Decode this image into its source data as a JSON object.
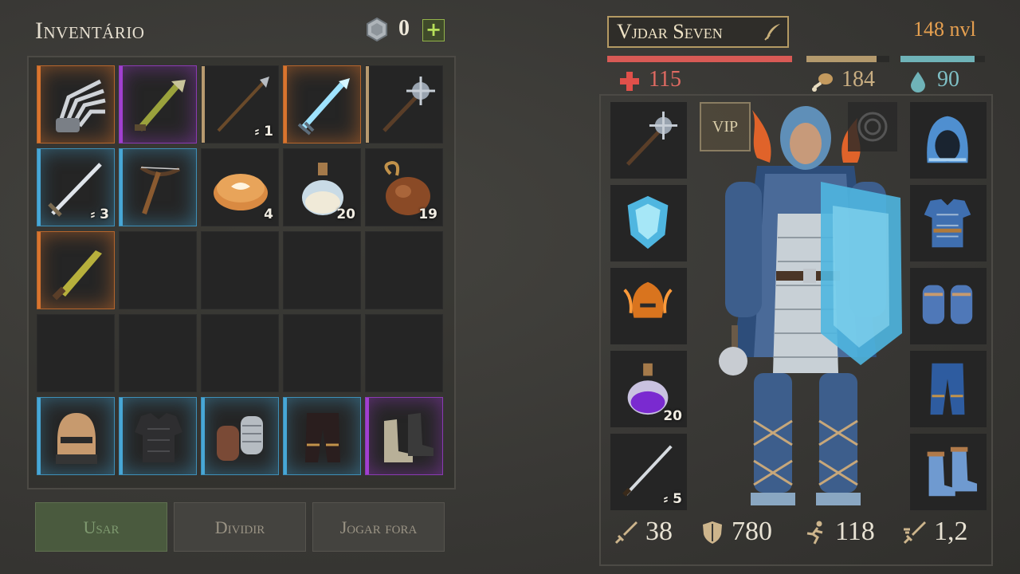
{
  "inventory": {
    "title": "Inventário",
    "coins": "0",
    "plus": "+"
  },
  "slots": [
    {
      "row": 0,
      "col": 0,
      "rarity": "orange",
      "icon": "claw-gauntlet-icon",
      "qty": ""
    },
    {
      "row": 0,
      "col": 1,
      "rarity": "purple",
      "icon": "bone-club-icon",
      "qty": ""
    },
    {
      "row": 0,
      "col": 2,
      "rarity": "tan",
      "icon": "spear-icon",
      "qty": "1",
      "dur": true
    },
    {
      "row": 0,
      "col": 3,
      "rarity": "orange",
      "icon": "ice-sword-icon",
      "qty": ""
    },
    {
      "row": 0,
      "col": 4,
      "rarity": "tan",
      "icon": "mace-icon",
      "qty": ""
    },
    {
      "row": 1,
      "col": 0,
      "rarity": "blue",
      "icon": "longsword-icon",
      "qty": "3",
      "dur": true
    },
    {
      "row": 1,
      "col": 1,
      "rarity": "blue",
      "icon": "crossbow-icon",
      "qty": ""
    },
    {
      "row": 1,
      "col": 2,
      "rarity": "none",
      "icon": "pie-icon",
      "qty": "4"
    },
    {
      "row": 1,
      "col": 3,
      "rarity": "none",
      "icon": "potion-bottle-icon",
      "qty": "20"
    },
    {
      "row": 1,
      "col": 4,
      "rarity": "none",
      "icon": "waterskin-icon",
      "qty": "19"
    },
    {
      "row": 2,
      "col": 0,
      "rarity": "orange",
      "icon": "machete-icon",
      "qty": ""
    },
    {
      "row": 4,
      "col": 0,
      "rarity": "blue",
      "icon": "helmet-icon",
      "qty": ""
    },
    {
      "row": 4,
      "col": 1,
      "rarity": "blue",
      "icon": "chest-armor-icon",
      "qty": ""
    },
    {
      "row": 4,
      "col": 2,
      "rarity": "blue",
      "icon": "gloves-icon",
      "qty": ""
    },
    {
      "row": 4,
      "col": 3,
      "rarity": "blue",
      "icon": "pants-icon",
      "qty": ""
    },
    {
      "row": 4,
      "col": 4,
      "rarity": "purple",
      "icon": "boots-icon",
      "qty": ""
    }
  ],
  "buttons": {
    "use": "Usar",
    "split": "Dividir",
    "discard": "Jogar fora"
  },
  "character": {
    "name": "Vjdar Seven",
    "level": "148 nvl",
    "health": "115",
    "food": "184",
    "water": "90",
    "health_fill": 1.0,
    "food_fill": 0.85,
    "water_fill": 0.88,
    "vip": "VIP",
    "equip_left": [
      {
        "icon": "mace-icon",
        "rarity": "tan",
        "qty": ""
      },
      {
        "icon": "ice-shield-icon",
        "rarity": "orange",
        "qty": ""
      },
      {
        "icon": "fire-helm-icon",
        "rarity": "purple",
        "qty": ""
      },
      {
        "icon": "purple-potion-icon",
        "rarity": "none",
        "qty": "20"
      },
      {
        "icon": "katana-icon",
        "rarity": "orange",
        "qty": "5",
        "dur": true
      }
    ],
    "equip_right": [
      {
        "icon": "hood-icon",
        "rarity": "purple"
      },
      {
        "icon": "torso-armor-icon",
        "rarity": "purple"
      },
      {
        "icon": "gauntlets-icon",
        "rarity": "purple"
      },
      {
        "icon": "leggings-icon",
        "rarity": "purple"
      },
      {
        "icon": "fur-boots-icon",
        "rarity": "purple"
      }
    ],
    "stats": {
      "attack": "38",
      "armor": "780",
      "speed": "118",
      "attack_speed": "1,2"
    }
  },
  "colors": {
    "orange": "#d9742e",
    "purple": "#a13fd0",
    "blue": "#47a7d6",
    "tan": "#b79a6f",
    "health": "#d85a55",
    "food": "#b49a6d",
    "water": "#6fb3b8"
  }
}
